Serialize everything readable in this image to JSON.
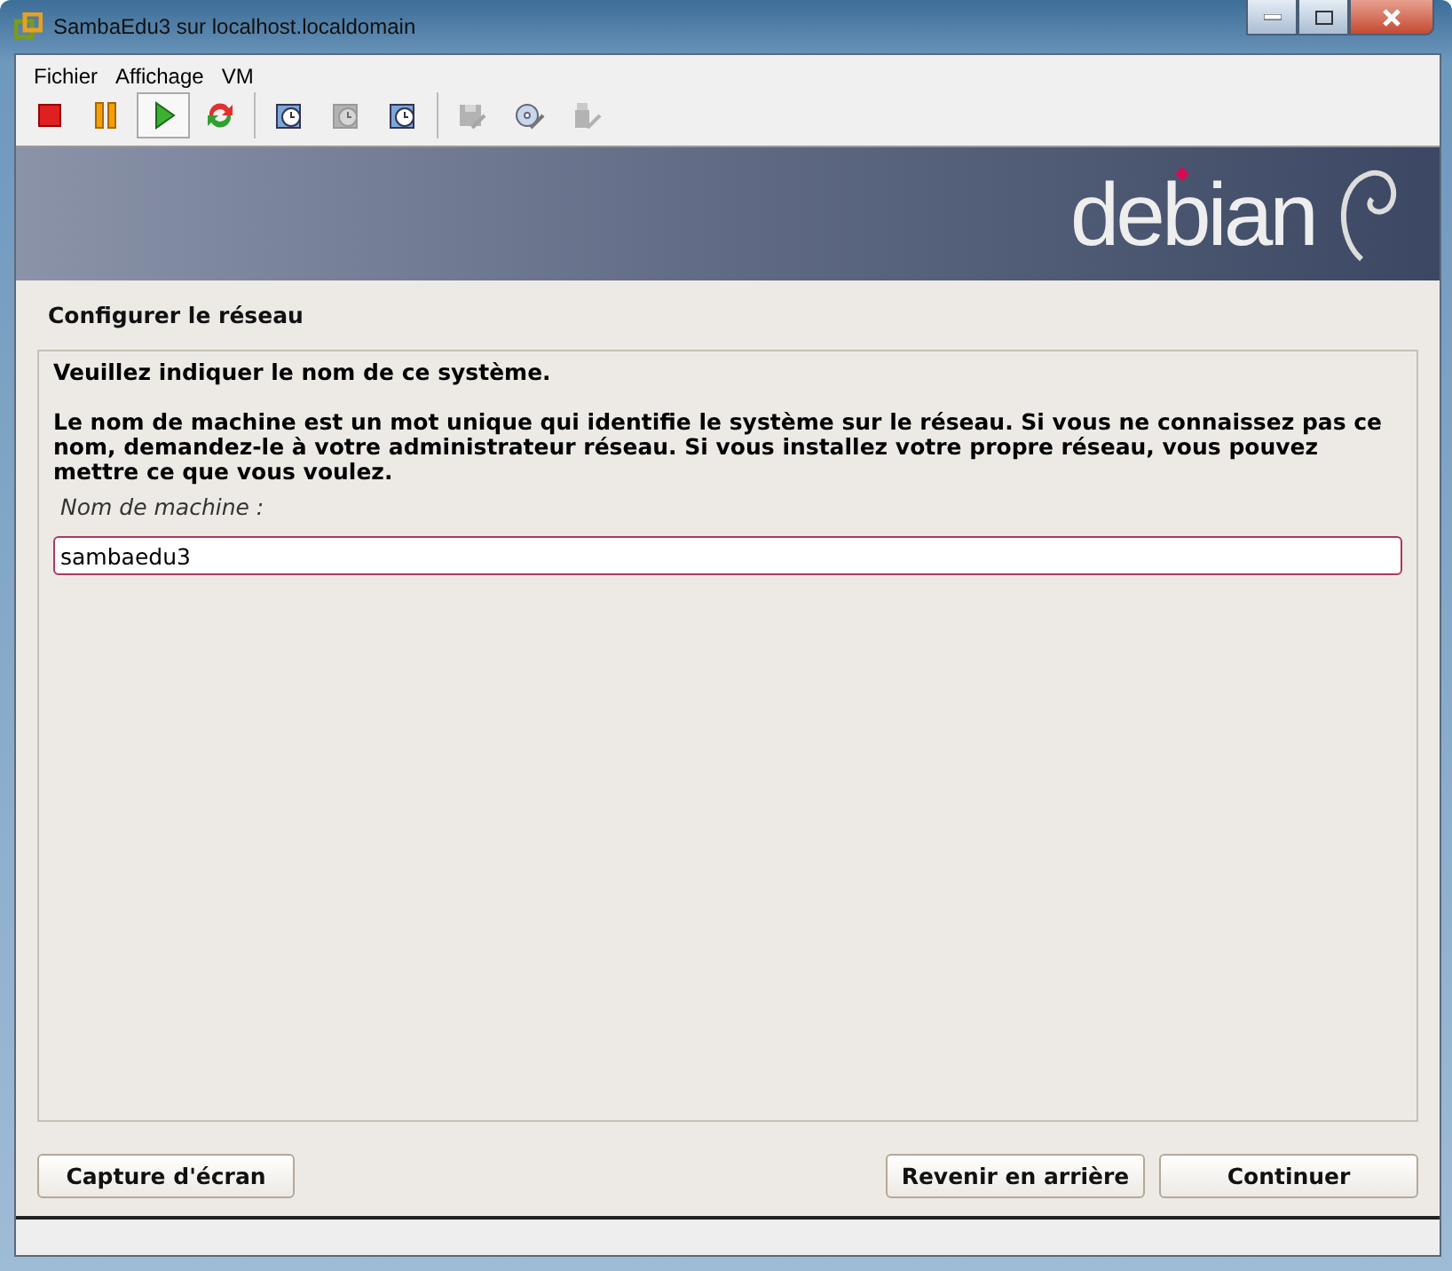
{
  "window": {
    "title": "SambaEdu3 sur localhost.localdomain"
  },
  "menu": [
    "Fichier",
    "Affichage",
    "VM"
  ],
  "toolbar": [
    {
      "kind": "stop",
      "pressed": false,
      "disabled": false
    },
    {
      "kind": "pause",
      "pressed": false,
      "disabled": false
    },
    {
      "kind": "play",
      "pressed": true,
      "disabled": false
    },
    {
      "kind": "reset",
      "pressed": false,
      "disabled": false
    },
    {
      "kind": "sep"
    },
    {
      "kind": "snapshot",
      "pressed": false,
      "disabled": false
    },
    {
      "kind": "revert",
      "pressed": false,
      "disabled": true
    },
    {
      "kind": "manage",
      "pressed": false,
      "disabled": false
    },
    {
      "kind": "sep"
    },
    {
      "kind": "floppy",
      "pressed": false,
      "disabled": true
    },
    {
      "kind": "cd",
      "pressed": false,
      "disabled": false
    },
    {
      "kind": "usb",
      "pressed": false,
      "disabled": true
    }
  ],
  "banner": {
    "logo": "debian"
  },
  "installer": {
    "title": "Configurer le réseau",
    "question": "Veuillez indiquer le nom de ce système.",
    "description": "Le nom de machine est un mot unique qui identifie le système sur le réseau. Si vous ne connaissez pas ce nom, demandez-le à votre administrateur réseau. Si vous installez votre propre réseau, vous pouvez mettre ce que vous voulez.",
    "field_label": "Nom de machine :",
    "field_value": "sambaedu3"
  },
  "buttons": {
    "left": [
      "Capture d'écran"
    ],
    "right": [
      "Revenir en arrière",
      "Continuer"
    ]
  }
}
